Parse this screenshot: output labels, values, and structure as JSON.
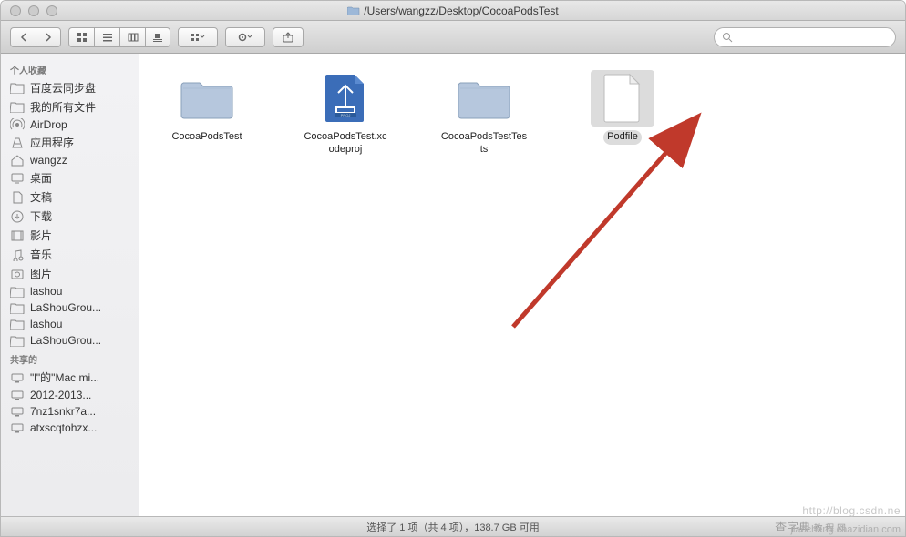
{
  "titlebar": {
    "path": "/Users/wangzz/Desktop/CocoaPodsTest"
  },
  "toolbar": {
    "search_placeholder": ""
  },
  "sidebar": {
    "sections": [
      {
        "header": "个人收藏",
        "items": [
          {
            "icon": "folder",
            "label": "百度云同步盘"
          },
          {
            "icon": "folder",
            "label": "我的所有文件"
          },
          {
            "icon": "airdrop",
            "label": "AirDrop"
          },
          {
            "icon": "apps",
            "label": "应用程序"
          },
          {
            "icon": "home",
            "label": "wangzz"
          },
          {
            "icon": "desktop",
            "label": "桌面"
          },
          {
            "icon": "documents",
            "label": "文稿"
          },
          {
            "icon": "downloads",
            "label": "下载"
          },
          {
            "icon": "movies",
            "label": "影片"
          },
          {
            "icon": "music",
            "label": "音乐"
          },
          {
            "icon": "pictures",
            "label": "图片"
          },
          {
            "icon": "folder",
            "label": "lashou"
          },
          {
            "icon": "folder",
            "label": "LaShouGrou..."
          },
          {
            "icon": "folder",
            "label": "lashou"
          },
          {
            "icon": "folder",
            "label": "LaShouGrou..."
          }
        ]
      },
      {
        "header": "共享的",
        "items": [
          {
            "icon": "computer",
            "label": "\"l\"的\"Mac mi..."
          },
          {
            "icon": "computer",
            "label": "2012-2013..."
          },
          {
            "icon": "computer",
            "label": "7nz1snkr7a..."
          },
          {
            "icon": "computer",
            "label": "atxscqtohzx..."
          }
        ]
      }
    ]
  },
  "content": {
    "items": [
      {
        "type": "folder",
        "label": "CocoaPodsTest",
        "selected": false
      },
      {
        "type": "xcodeproj",
        "label": "CocoaPodsTest.xcodeproj",
        "selected": false
      },
      {
        "type": "folder",
        "label": "CocoaPodsTestTests",
        "selected": false
      },
      {
        "type": "file",
        "label": "Podfile",
        "selected": true
      }
    ]
  },
  "statusbar": {
    "text": "选择了 1 项（共 4 项），138.7 GB 可用"
  },
  "watermarks": {
    "url": "http://blog.csdn.ne",
    "brand": "查字典",
    "sub": "教 程 网",
    "domain": "jiaocheng.chazidian.com"
  }
}
